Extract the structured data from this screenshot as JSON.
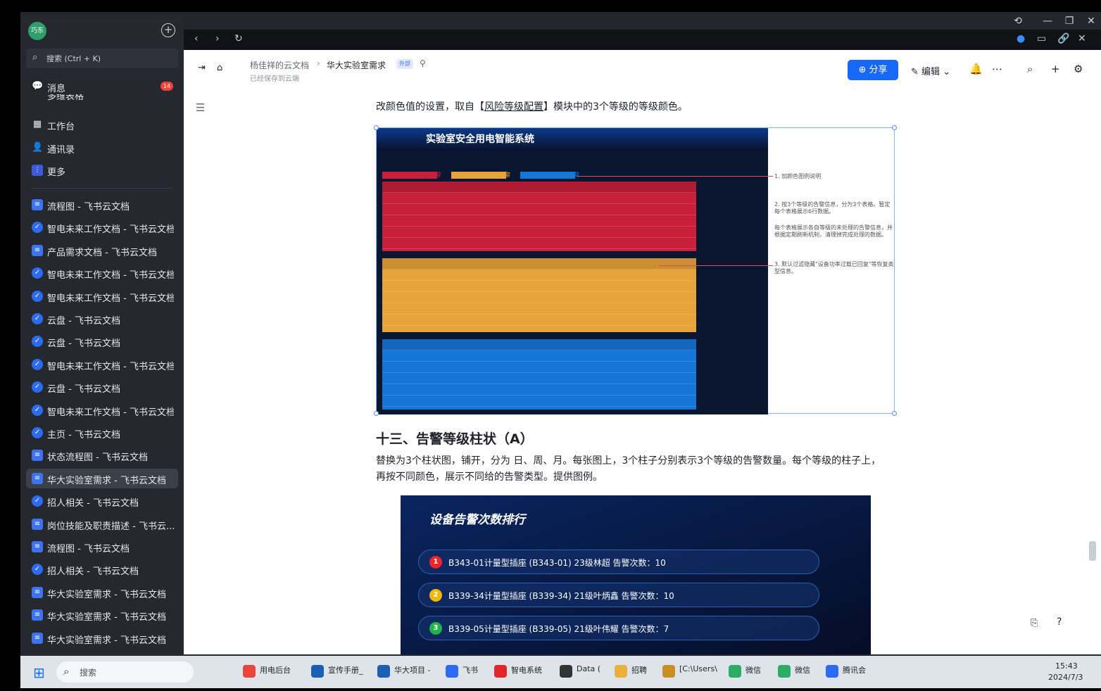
{
  "sidebar": {
    "avatar_text": "巧东",
    "search_placeholder": "搜索 (Ctrl + K)",
    "messages_label": "消息",
    "messages_badge": "14",
    "cut_item": "多维表格",
    "nav": [
      "工作台",
      "通讯录",
      "更多"
    ],
    "docs": [
      {
        "label": "流程图 - 飞书云文档",
        "kind": "doc"
      },
      {
        "label": "智电未来工作文档 - 飞书云文档",
        "kind": "feishu"
      },
      {
        "label": "产品需求文档 - 飞书云文档",
        "kind": "doc"
      },
      {
        "label": "智电未来工作文档 - 飞书云文档",
        "kind": "feishu"
      },
      {
        "label": "智电未来工作文档 - 飞书云文档",
        "kind": "feishu"
      },
      {
        "label": "云盘 - 飞书云文档",
        "kind": "feishu"
      },
      {
        "label": "云盘 - 飞书云文档",
        "kind": "feishu"
      },
      {
        "label": "智电未来工作文档 - 飞书云文档",
        "kind": "feishu"
      },
      {
        "label": "云盘 - 飞书云文档",
        "kind": "feishu"
      },
      {
        "label": "智电未来工作文档 - 飞书云文档",
        "kind": "feishu"
      },
      {
        "label": "主页 - 飞书云文档",
        "kind": "feishu"
      },
      {
        "label": "状态流程图 - 飞书云文档",
        "kind": "doc"
      },
      {
        "label": "华大实验室需求 - 飞书云文档",
        "kind": "doc",
        "active": true
      },
      {
        "label": "招人相关 - 飞书云文档",
        "kind": "feishu"
      },
      {
        "label": "岗位技能及职责描述 - 飞书云...",
        "kind": "doc"
      },
      {
        "label": "流程图 - 飞书云文档",
        "kind": "doc"
      },
      {
        "label": "招人相关 - 飞书云文档",
        "kind": "feishu"
      },
      {
        "label": "华大实验室需求 - 飞书云文档",
        "kind": "doc"
      },
      {
        "label": "华大实验室需求 - 飞书云文档",
        "kind": "doc"
      },
      {
        "label": "华大实验室需求 - 飞书云文档",
        "kind": "doc"
      }
    ]
  },
  "header": {
    "breadcrumb_root": "杨佳祥的云文档",
    "breadcrumb_current": "华大实验室需求",
    "external_tag": "外部",
    "saved_status": "已经保存到云端",
    "share_label": "分享",
    "edit_label": "编辑"
  },
  "content": {
    "paragraph1_pre": "改颜色值的设置，取自【",
    "paragraph1_link": "风险等级配置",
    "paragraph1_post": "】模块中的3个等级的等级颜色。",
    "img1": {
      "title": "实验室安全用电智能系统",
      "legend": [
        "一级告警",
        "二级告警",
        "三级告警"
      ],
      "annotations": [
        "1. 加颜色图例说明",
        "2. 按3个等级的告警信息，分为3个表格。暂定每个表格展示6行数据。",
        "每个表格展示各自等级的未处理的告警信息，并根据定期刷新机制，清理掉完成处理的数据。",
        "3. 默认过滤隐藏\"设备功率过载已回复\"等恢复类型信息。"
      ],
      "colors": {
        "red": "#c8203a",
        "orange": "#e5a33a",
        "blue": "#1676d8"
      }
    },
    "section_title": "十三、告警等级柱状（A）",
    "paragraph2": "替换为3个柱状图，铺开，分为 日、周、月。每张图上，3个柱子分别表示3个等级的告警数量。每个等级的柱子上，再按不同颜色，展示不同给的告警类型。提供图例。",
    "img2": {
      "title": "设备告警次数排行",
      "rows": [
        {
          "num": "1",
          "text": "B343-01计量型插座 (B343-01) 23级林超  告警次数：10",
          "color": "#e8262b"
        },
        {
          "num": "2",
          "text": "B339-34计量型插座 (B339-34) 21级叶炳鑫  告警次数：10",
          "color": "#f2b705"
        },
        {
          "num": "3",
          "text": "B339-05计量型插座 (B339-05) 21级叶伟耀  告警次数：7",
          "color": "#22b14c"
        }
      ]
    }
  },
  "taskbar": {
    "search_placeholder": "搜索",
    "apps": [
      "用电后台",
      "宣传手册_",
      "华大项目 -",
      "飞书",
      "智电系统",
      "Data (",
      "招聘",
      "[C:\\Users\\",
      "微信",
      "微信",
      "腾讯会"
    ],
    "time": "15:43",
    "date": "2024/7/3"
  }
}
